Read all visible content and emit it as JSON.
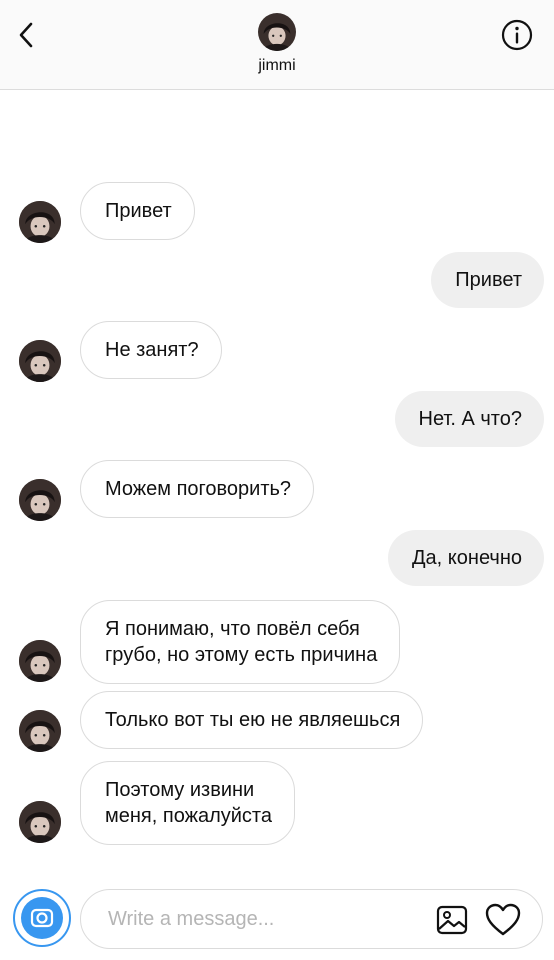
{
  "header": {
    "username": "jimmi",
    "back_icon": "chevron-left-icon",
    "info_icon": "info-circle-icon"
  },
  "messages": [
    {
      "from": "them",
      "text": "Привет"
    },
    {
      "from": "me",
      "text": "Привет"
    },
    {
      "from": "them",
      "text": "Не занят?"
    },
    {
      "from": "me",
      "text": "Нет. А что?"
    },
    {
      "from": "them",
      "text": "Можем поговорить?"
    },
    {
      "from": "me",
      "text": "Да, конечно"
    },
    {
      "from": "them",
      "lines": [
        "Я понимаю, что повёл себя",
        "грубо, но этому есть причина"
      ]
    },
    {
      "from": "them",
      "text": "Только вот ты ею не являешься"
    },
    {
      "from": "them",
      "lines": [
        "Поэтому извини",
        "меня, пожалуйста"
      ]
    }
  ],
  "composer": {
    "placeholder": "Write a message...",
    "camera_icon": "camera-icon",
    "gallery_icon": "image-icon",
    "heart_icon": "heart-icon"
  },
  "colors": {
    "accent": "#3897f0",
    "outgoing_bubble": "#efefef",
    "incoming_border": "#dbdbdb",
    "header_bg": "#fafafa"
  }
}
